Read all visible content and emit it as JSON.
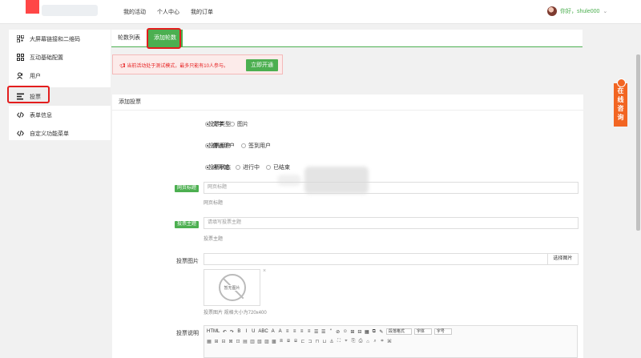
{
  "header": {
    "nav": [
      "我的活动",
      "个人中心",
      "我的订单"
    ],
    "user_greeting": "你好，shule000",
    "user_caret": "⌄"
  },
  "sidebar": {
    "items": [
      {
        "label": "大屏幕链接和二维码",
        "icon": "qrcode-icon"
      },
      {
        "label": "互动基础配置",
        "icon": "grid-icon"
      },
      {
        "label": "用户",
        "icon": "users-icon"
      },
      {
        "label": "投票",
        "icon": "list-icon",
        "active": true
      },
      {
        "label": "表单信息",
        "icon": "code-icon"
      },
      {
        "label": "自定义功能菜单",
        "icon": "code-icon"
      }
    ]
  },
  "tabs": {
    "items": [
      "轮数列表",
      "添加轮数"
    ],
    "active_index": 1
  },
  "notice": {
    "text": "当前活动处于测试模式，最多只能有10人参与。",
    "button": "立即开通"
  },
  "form": {
    "panel_title": "添加投票",
    "vote_type": {
      "label": "投票类型",
      "options": [
        "文字",
        "图片"
      ],
      "selected": 0
    },
    "vote_user": {
      "label": "投票用户",
      "options": [
        "普通用户",
        "签到用户"
      ],
      "selected": 0
    },
    "vote_status": {
      "label": "投票状态",
      "options": [
        "未开始",
        "进行中",
        "已结束"
      ],
      "selected": 0
    },
    "page_title": {
      "badge": "网页标题",
      "placeholder": "网页标题",
      "help": "网页标题"
    },
    "vote_subject": {
      "badge": "投票主题",
      "placeholder": "请填写投票主题",
      "help": "投票主题"
    },
    "vote_image": {
      "label": "投票图片",
      "select_button": "选择图片",
      "no_image": "暂无图片",
      "help": "投票图片 规格大小为720x400"
    },
    "vote_desc": {
      "label": "投票说明"
    }
  },
  "editor": {
    "row1": [
      "HTML",
      "↶",
      "↷",
      "B",
      "I",
      "U",
      "ABC",
      "A",
      "A",
      "≡",
      "≡",
      "≡",
      "≡",
      "☰",
      "☰",
      "“",
      "⊘",
      "☺",
      "⊞",
      "⊟",
      "▦",
      "⧉",
      "✎"
    ],
    "selects": [
      "段落格式",
      "字体",
      "字号"
    ],
    "row2_count": 26
  },
  "consult": {
    "text": "在线咨询"
  },
  "colors": {
    "accent": "#4caf50",
    "highlight": "#e31d1d",
    "consult": "#f26522"
  }
}
